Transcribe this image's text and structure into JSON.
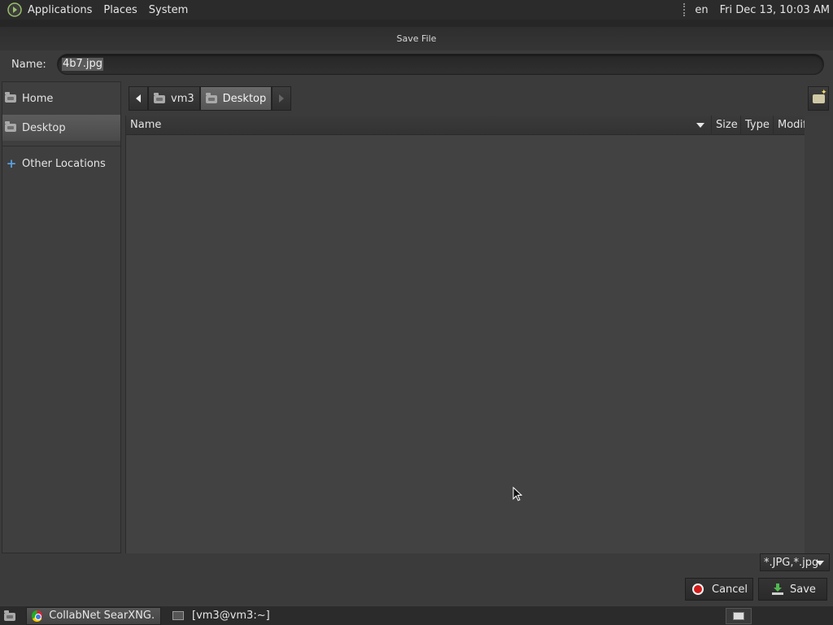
{
  "top_panel": {
    "menus": [
      "Applications",
      "Places",
      "System"
    ],
    "keyboard_layout": "en",
    "clock": "Fri Dec 13, 10:03 AM"
  },
  "dialog": {
    "title": "Save File",
    "name_label": "Name:",
    "name_value": "4b7.jpg",
    "sidebar": {
      "items": [
        {
          "label": "Home",
          "icon": "folder-home-icon",
          "active": false
        },
        {
          "label": "Desktop",
          "icon": "folder-icon",
          "active": true
        },
        {
          "label": "Other Locations",
          "icon": "plus-icon",
          "active": false
        }
      ]
    },
    "pathbar": {
      "segments": [
        {
          "label": "vm3",
          "active": false
        },
        {
          "label": "Desktop",
          "active": true
        }
      ]
    },
    "columns": [
      "Name",
      "Size",
      "Type",
      "Modif"
    ],
    "filter": "*.JPG,*.jpg",
    "buttons": {
      "cancel": "Cancel",
      "save": "Save"
    }
  },
  "taskbar": {
    "tasks": [
      {
        "label": "CollabNet SearXNG...",
        "icon": "chrome-icon",
        "active": true
      },
      {
        "label": "[vm3@vm3:~]",
        "icon": "terminal-icon",
        "active": false
      }
    ]
  },
  "colors": {
    "background": "#3a3a3a",
    "panel": "#2b2b2b",
    "cancel_accent": "#d21b1b",
    "save_accent": "#4fb84f",
    "other_locations_accent": "#5aa0e0"
  }
}
